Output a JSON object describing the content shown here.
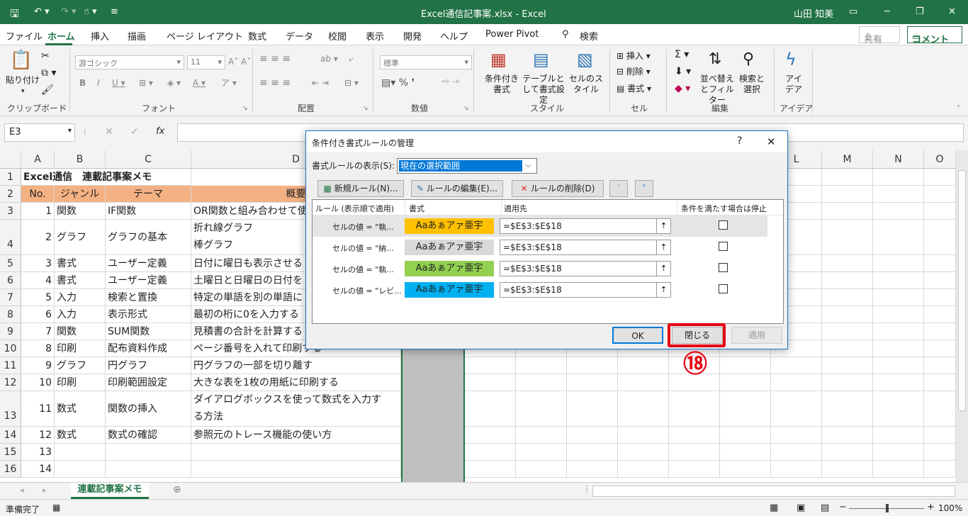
{
  "titlebar": {
    "filename": "Excel通信記事案.xlsx - Excel",
    "user": "山田 知美",
    "colors": {
      "bg": "#217346"
    }
  },
  "tabs": [
    "ファイル",
    "ホーム",
    "挿入",
    "描画",
    "ページ レイアウト",
    "数式",
    "データ",
    "校閲",
    "表示",
    "開発",
    "ヘルプ",
    "Power Pivot",
    "検索"
  ],
  "active_tab": "ホーム",
  "share_label": "共有",
  "comment_label": "コメント",
  "ribbon": {
    "paste_label": "貼り付け",
    "font_name": "游ゴシック",
    "font_size": "11",
    "number_format": "標準",
    "cond_format": "条件付き書式",
    "table_format": "テーブルとして書式設定",
    "cell_style": "セルのスタイル",
    "insert": "挿入",
    "delete": "削除",
    "format": "書式",
    "sort_filter": "並べ替えとフィルター",
    "find_select": "検索と選択",
    "ideas": "アイデア",
    "groups": [
      "クリップボード",
      "フォント",
      "配置",
      "数値",
      "スタイル",
      "セル",
      "編集",
      "アイデア"
    ]
  },
  "formula_bar": {
    "name_box": "E3",
    "fx": "fx",
    "formula": ""
  },
  "columns": [
    "A",
    "B",
    "C",
    "D",
    "L",
    "M",
    "N",
    "O"
  ],
  "rows": [
    {
      "num": "1",
      "a": "Excel通信　連載記事案メモ",
      "b": "",
      "c": "",
      "d": ""
    },
    {
      "num": "2",
      "a": "No.",
      "b": "ジャンル",
      "c": "テーマ",
      "d": "概要"
    },
    {
      "num": "3",
      "a": "1",
      "b": "関数",
      "c": "IF関数",
      "d": "OR関数と組み合わせて使"
    },
    {
      "num": "4",
      "a": "2",
      "b": "グラフ",
      "c": "グラフの基本",
      "d": "折れ線グラフ",
      "d2": "棒グラフ"
    },
    {
      "num": "5",
      "a": "3",
      "b": "書式",
      "c": "ユーザー定義",
      "d": "日付に曜日も表示させる"
    },
    {
      "num": "6",
      "a": "4",
      "b": "書式",
      "c": "ユーザー定義",
      "d": "土曜日と日曜日の日付を"
    },
    {
      "num": "7",
      "a": "5",
      "b": "入力",
      "c": "検索と置換",
      "d": "特定の単語を別の単語に"
    },
    {
      "num": "8",
      "a": "6",
      "b": "入力",
      "c": "表示形式",
      "d": "最初の桁に0を入力する"
    },
    {
      "num": "9",
      "a": "7",
      "b": "関数",
      "c": "SUM関数",
      "d": "見積書の合計を計算する"
    },
    {
      "num": "10",
      "a": "8",
      "b": "印刷",
      "c": "配布資料作成",
      "d": "ページ番号を入れて印刷する"
    },
    {
      "num": "11",
      "a": "9",
      "b": "グラフ",
      "c": "円グラフ",
      "d": "円グラフの一部を切り離す"
    },
    {
      "num": "12",
      "a": "10",
      "b": "印刷",
      "c": "印刷範囲設定",
      "d": "大きな表を1枚の用紙に印刷する"
    },
    {
      "num": "13",
      "a": "11",
      "b": "数式",
      "c": "関数の挿入",
      "d": "ダイアログボックスを使って数式を入力す",
      "d2": "る方法"
    },
    {
      "num": "14",
      "a": "12",
      "b": "数式",
      "c": "数式の確認",
      "d": "参照元のトレース機能の使い方"
    },
    {
      "num": "15",
      "a": "13",
      "b": "",
      "c": "",
      "d": ""
    },
    {
      "num": "16",
      "a": "14",
      "b": "",
      "c": "",
      "d": ""
    }
  ],
  "sheet_tab": "連載記事案メモ",
  "status": {
    "ready": "準備完了",
    "zoom": "100%"
  },
  "dialog": {
    "title": "条件付き書式ルールの管理",
    "help": "?",
    "close_x": "✕",
    "show_rules_label": "書式ルールの表示(S):",
    "show_rules_value": "現在の選択範囲",
    "new_rule": "新規ルール(N)...",
    "edit_rule": "ルールの編集(E)...",
    "delete_rule": "ルールの削除(D)",
    "col_rule": "ルール (表示順で適用)",
    "col_format": "書式",
    "col_applies": "適用先",
    "col_stop": "条件を満たす場合は停止",
    "rules": [
      {
        "rule": "セルの値 = \"執...",
        "preview": "Aaあぁアァ亜宇",
        "fill": "#ffc000",
        "applies": "=$E$3:$E$18"
      },
      {
        "rule": "セルの値 = \"納...",
        "preview": "Aaあぁアァ亜宇",
        "fill": "#d9d9d9",
        "applies": "=$E$3:$E$18"
      },
      {
        "rule": "セルの値 = \"執...",
        "preview": "Aaあぁアァ亜宇",
        "fill": "#92d050",
        "applies": "=$E$3:$E$18"
      },
      {
        "rule": "セルの値 = \"レビ...",
        "preview": "Aaあぁアァ亜宇",
        "fill": "#00b0f0",
        "applies": "=$E$3:$E$18"
      }
    ],
    "ok": "OK",
    "close": "閉じる",
    "apply": "適用"
  },
  "annotation": {
    "step": "⑱",
    "color": "#e60012"
  }
}
